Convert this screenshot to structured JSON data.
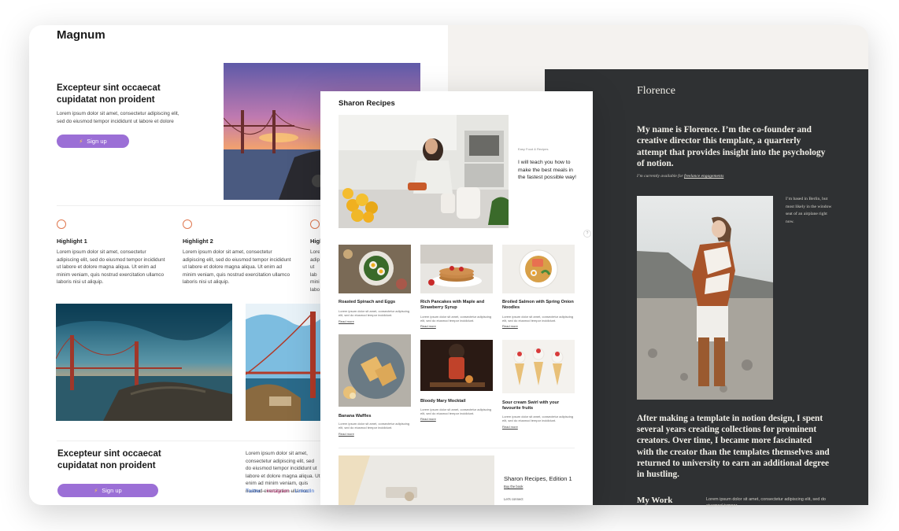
{
  "magnum": {
    "logo": "Magnum",
    "hero_heading": "Excepteur sint occaecat cupidatat non proident",
    "hero_text": "Lorem ipsum dolor sit amet, consectetur adipiscing elit, sed do eiusmod tempor incididunt ut labore et dolore",
    "hero_button": "Sign up",
    "highlights": [
      {
        "title": "Highlight 1",
        "text": "Lorem ipsum dolor sit amet, consectetur adipiscing elit, sed do eiusmod tempor incididunt ut labore et dolore magna aliqua. Ut enim ad minim veniam, quis nostrud exercitation ullamco laboris nisi ut aliquip."
      },
      {
        "title": "Highlight 2",
        "text": "Lorem ipsum dolor sit amet, consectetur adipiscing elit, sed do eiusmod tempor incididunt ut labore et dolore magna aliqua. Ut enim ad minim veniam, quis nostrud exercitation ullamco laboris nisi ut aliquip."
      },
      {
        "title": "High",
        "text": "Lore adipi ut lab mini labor"
      }
    ],
    "bottom_heading": "Excepteur sint occaecat cupidatat non proident",
    "bottom_button": "Sign up",
    "bottom_text": "Lorem ipsum dolor sit amet, consectetur adipiscing elit, sed do eiusmod tempor incididunt ut labore et dolore magna aliqua. Ut enim ad minim veniam, quis nostrud exercitation ullamco",
    "links": {
      "twitter": "Twitter",
      "instagram": "Instagram",
      "linkedin": "LinkedIn",
      "separator": "–"
    }
  },
  "sharon": {
    "title": "Sharon Recipes",
    "category": "Easy Food & Recipes",
    "tagline": "I will teach you how to make the best meals in the fastest possible way!",
    "help": "?",
    "recipes": [
      {
        "title": "Roasted Spinach and Eggs",
        "desc": "Lorem ipsum dolor sit amet, consectetur adipiscing elit, sed do eiusmod tempor incididunt.",
        "more": "Read more"
      },
      {
        "title": "Rich Pancakes with Maple and Strawberry Syrup",
        "desc": "Lorem ipsum dolor sit amet, consectetur adipiscing elit, sed do eiusmod tempor incididunt.",
        "more": "Read more"
      },
      {
        "title": "Broiled Salmon with Spring Onion Noodles",
        "desc": "Lorem ipsum dolor sit amet, consectetur adipiscing elit, sed do eiusmod tempor incididunt.",
        "more": "Read more"
      },
      {
        "title": "Banana Waffles",
        "desc": "Lorem ipsum dolor sit amet, consectetur adipiscing elit, sed do eiusmod tempor incididunt.",
        "more": "Read more"
      },
      {
        "title": "Bloody Mary Mocktail",
        "desc": "Lorem ipsum dolor sit amet, consectetur adipiscing elit, sed do eiusmod tempor incididunt.",
        "more": "Read more"
      },
      {
        "title": "Sour cream Swirl with your favourite fruits",
        "desc": "Lorem ipsum dolor sit amet, consectetur adipiscing elit, sed do eiusmod tempor incididunt.",
        "more": "Read more"
      }
    ],
    "edition_title": "Sharon Recipes, Edition 1",
    "edition_link": "Buy the book",
    "connect": "Let's connect"
  },
  "florence": {
    "title": "Florence",
    "intro": "My name is Florence. I’m the co-founder and creative director this template, a quarterly attempt that provides insight into the psychology of notion.",
    "availability_prefix": "I’m currently available for",
    "availability_link": "freelance engagements",
    "side_note": "I’m based in Berlin, but most likely in the window seat of an airplane right now.",
    "paragraph": "After making a  template in notion design, I spent several years creating collections for prominent creators. Over time, I became more fascinated with the creator than the templates themselves and returned to university to earn an additional degree in hustling.",
    "work_heading": "My Work",
    "work_text": "Lorem ipsum dolor sit amet, consectetur adipiscing elit, sed do eiusmod tempor"
  }
}
